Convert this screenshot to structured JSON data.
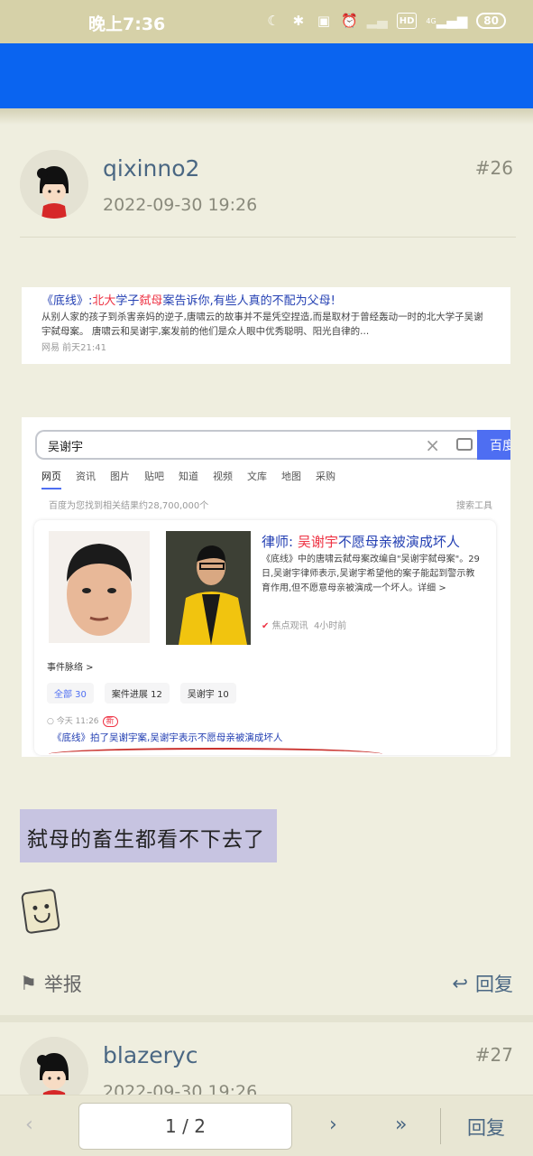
{
  "status_bar": {
    "time": "晚上7:36",
    "network": "4G",
    "battery": "80"
  },
  "posts": [
    {
      "username": "qixinno2",
      "time": "2022-09-30 19:26",
      "floor": "#26",
      "screenshot1": {
        "title_prefix": "《底线》:",
        "title_red1": "北大",
        "title_mid": "学子",
        "title_red2": "弑母",
        "title_suffix": "案告诉你,有些人真的不配为父母!",
        "body": "从别人家的孩子到杀害亲妈的逆子,唐啸云的故事并不是凭空捏造,而是取材于曾经轰动一时的北大学子吴谢宇弑母案。 唐啸云和吴谢宇,案发前的他们是众人眼中优秀聪明、阳光自律的...",
        "source": "网易 前天21:41"
      },
      "screenshot2": {
        "query": "吴谢宇",
        "search_button": "百度",
        "tabs": [
          "网页",
          "资讯",
          "图片",
          "贴吧",
          "知道",
          "视频",
          "文库",
          "地图",
          "采购"
        ],
        "result_count": "百度为您找到相关结果约28,700,000个",
        "search_tools": "搜索工具",
        "card_title_prefix": "律师: ",
        "card_title_red": "吴谢宇",
        "card_title_suffix": "不愿母亲被演成坏人",
        "card_body": "《底线》中的唐啸云弑母案改编自\"吴谢宇弑母案\"。29日,吴谢宇律师表示,吴谢宇希望他的案子能起到警示教育作用,但不愿意母亲被演成一个坏人。详细 >",
        "card_source_name": "焦点观讯",
        "card_source_time": "4小时前",
        "events_label": "事件脉络 >",
        "chips": [
          "全部 30",
          "案件进展 12",
          "吴谢宇 10"
        ],
        "timeline_time": "今天 11:26",
        "timeline_new": "新",
        "timeline_text": "《底线》拍了吴谢宇案,吴谢宇表示不愿母亲被演成坏人"
      },
      "caption": "弑母的畜生都看不下去了",
      "report_label": "举报",
      "reply_label": "回复"
    },
    {
      "username": "blazeryc",
      "time": "2022-09-30 19:26",
      "floor": "#27"
    }
  ],
  "bottom_nav": {
    "page_indicator": "1 / 2",
    "reply_label": "回复"
  }
}
